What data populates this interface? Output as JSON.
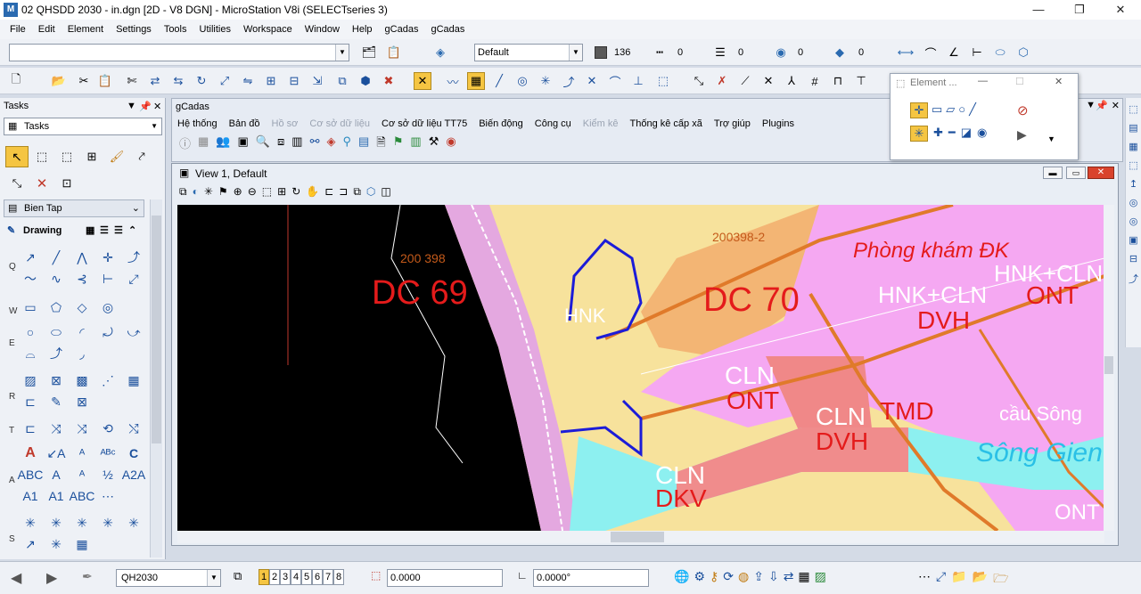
{
  "window": {
    "title": "02 QHSDD 2030 - in.dgn [2D - V8 DGN] - MicroStation V8i (SELECTseries 3)",
    "app_icon": "M"
  },
  "menu": [
    "File",
    "Edit",
    "Element",
    "Settings",
    "Tools",
    "Utilities",
    "Workspace",
    "Window",
    "Help",
    "gCadas",
    "gCadas"
  ],
  "attributes": {
    "level_value": "",
    "style": "Default",
    "color_num": "136",
    "linestyle_num": "0",
    "weight_num": "0",
    "transparency_num": "0",
    "priority_num": "0"
  },
  "tasks": {
    "header": "Tasks",
    "selector": "Tasks",
    "bientap": "Bien Tap",
    "drawing": "Drawing",
    "row_labels": [
      "Q",
      "W",
      "E",
      "R",
      "T",
      "A",
      "S"
    ]
  },
  "gcadas": {
    "header": "gCadas",
    "menu": [
      "Hệ thống",
      "Bản đồ",
      "Hồ sơ",
      "Cơ sở dữ liệu",
      "Cơ sở dữ liệu TT75",
      "Biến động",
      "Công cụ",
      "Kiểm kê",
      "Thống kê cấp xã",
      "Trợ giúp",
      "Plugins"
    ],
    "disabled": [
      2,
      3,
      7
    ]
  },
  "view": {
    "title": "View 1, Default"
  },
  "map_labels": {
    "dc69": "DC 69",
    "dc70": "DC 70",
    "id1": "200398-2",
    "id2": "200 398",
    "phongkham": "Phòng khám ĐK",
    "hnk1": "HNK",
    "hnkcln1": "HNK+CLN",
    "hnkcln2": "HNK+CLN",
    "dvh1": "DVH",
    "ont1": "ONT",
    "cln1": "CLN",
    "ont2": "ONT",
    "cln2": "CLN",
    "dvh2": "DVH",
    "tmd": "TMD",
    "causong": "cầu Sông",
    "songgien": "Sông Gien",
    "cln3": "CLN",
    "dkv": "DKV",
    "ont3": "ONT"
  },
  "element_float": {
    "title": "Element ..."
  },
  "status": {
    "level": "QH2030",
    "views": [
      "1",
      "2",
      "3",
      "4",
      "5",
      "6",
      "7",
      "8"
    ],
    "rotation": "0.0000",
    "angle": "0.0000°"
  }
}
